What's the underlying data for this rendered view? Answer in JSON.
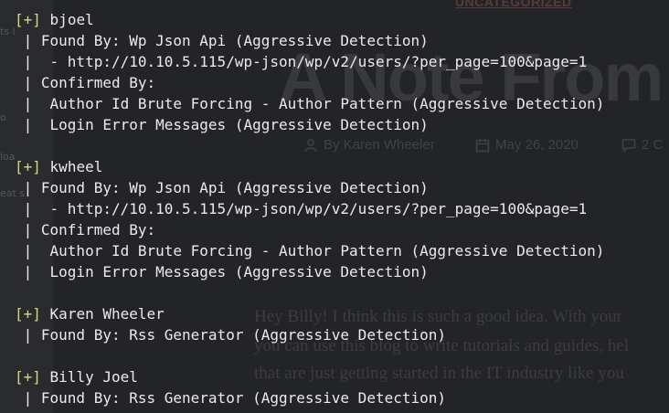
{
  "background_page": {
    "category": "UNCATEGORIZED",
    "title": "A Note From M",
    "meta": {
      "author": "By Karen Wheeler",
      "date": "May 26, 2020",
      "comments": "2 C"
    },
    "body_lines": [
      "Hey Billy!  I think this is such a good idea.  With your",
      "you can use this blog to write tutorials and guides, hel",
      "that are just getting started in the IT industry like you"
    ],
    "sidebar_fragments": [
      "ts l",
      "o",
      "loa",
      "eat s"
    ]
  },
  "terminal": {
    "marker": "[+]",
    "users": [
      {
        "name": "bjoel",
        "lines": [
          " | Found By: Wp Json Api (Aggressive Detection)",
          " |  - http://10.10.5.115/wp-json/wp/v2/users/?per_page=100&page=1",
          " | Confirmed By:",
          " |  Author Id Brute Forcing - Author Pattern (Aggressive Detection)",
          " |  Login Error Messages (Aggressive Detection)"
        ]
      },
      {
        "name": "kwheel",
        "lines": [
          " | Found By: Wp Json Api (Aggressive Detection)",
          " |  - http://10.10.5.115/wp-json/wp/v2/users/?per_page=100&page=1",
          " | Confirmed By:",
          " |  Author Id Brute Forcing - Author Pattern (Aggressive Detection)",
          " |  Login Error Messages (Aggressive Detection)"
        ]
      },
      {
        "name": "Karen Wheeler",
        "lines": [
          " | Found By: Rss Generator (Aggressive Detection)"
        ]
      },
      {
        "name": "Billy Joel",
        "lines": [
          " | Found By: Rss Generator (Aggressive Detection)"
        ]
      }
    ]
  },
  "colors": {
    "terminal_text": "#ebebeb",
    "marker": "#d4d77c",
    "background": "#1f2022"
  }
}
